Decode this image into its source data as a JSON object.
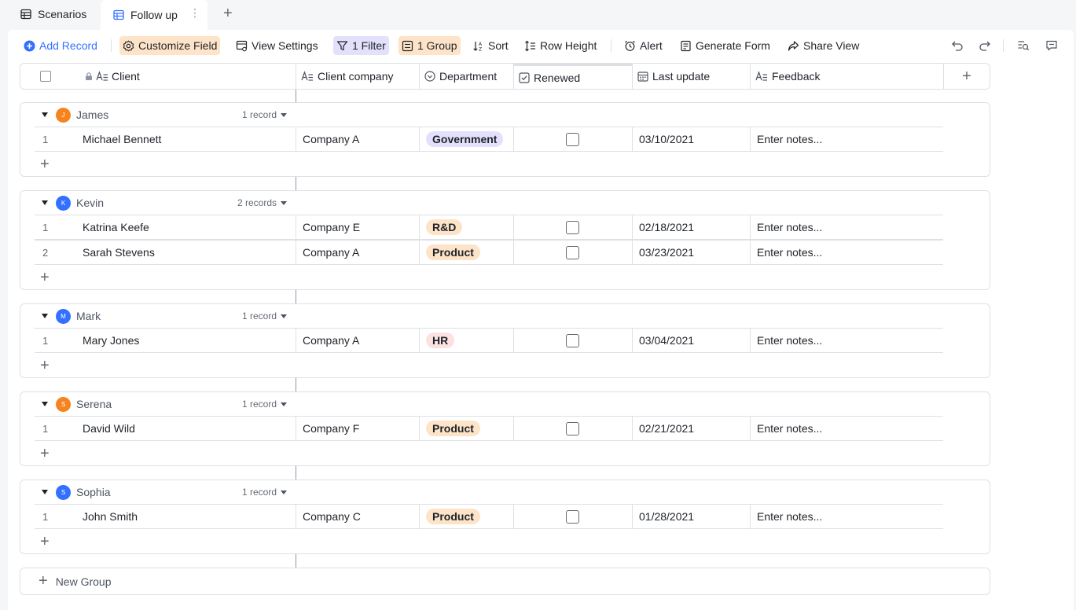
{
  "tabs": [
    {
      "label": "Scenarios",
      "icon": "grid-table-icon",
      "active": false
    },
    {
      "label": "Follow up",
      "icon": "grid-table-icon",
      "active": true
    }
  ],
  "toolbar": {
    "add_record": "Add Record",
    "customize_field": "Customize Field",
    "view_settings": "View Settings",
    "filter": "1 Filter",
    "group": "1 Group",
    "sort": "Sort",
    "row_height": "Row Height",
    "alert": "Alert",
    "generate_form": "Generate Form",
    "share_view": "Share View"
  },
  "columns": {
    "client": "Client",
    "client_company": "Client company",
    "department": "Department",
    "renewed": "Renewed",
    "last_update": "Last update",
    "feedback": "Feedback"
  },
  "groups": [
    {
      "name": "James",
      "initial": "J",
      "color": "#f5841f",
      "count": "1 record",
      "rows": [
        {
          "num": "1",
          "client": "Michael Bennett",
          "company": "Company A",
          "department": "Government",
          "dept_bg": "#e2e0fa",
          "last_update": "03/10/2021",
          "feedback": "Enter notes..."
        }
      ]
    },
    {
      "name": "Kevin",
      "initial": "K",
      "color": "#3370ff",
      "count": "2 records",
      "rows": [
        {
          "num": "1",
          "client": "Katrina Keefe",
          "company": "Company E",
          "department": "R&D",
          "dept_bg": "#fde3c7",
          "last_update": "02/18/2021",
          "feedback": "Enter notes..."
        },
        {
          "num": "2",
          "client": "Sarah Stevens",
          "company": "Company A",
          "department": "Product",
          "dept_bg": "#fde3c7",
          "last_update": "03/23/2021",
          "feedback": "Enter notes..."
        }
      ]
    },
    {
      "name": "Mark",
      "initial": "M",
      "color": "#3370ff",
      "count": "1 record",
      "rows": [
        {
          "num": "1",
          "client": "Mary Jones",
          "company": "Company A",
          "department": "HR",
          "dept_bg": "#fbe2e0",
          "last_update": "03/04/2021",
          "feedback": "Enter notes..."
        }
      ]
    },
    {
      "name": "Serena",
      "initial": "S",
      "color": "#f5841f",
      "count": "1 record",
      "rows": [
        {
          "num": "1",
          "client": "David Wild",
          "company": "Company F",
          "department": "Product",
          "dept_bg": "#fde3c7",
          "last_update": "02/21/2021",
          "feedback": "Enter notes..."
        }
      ]
    },
    {
      "name": "Sophia",
      "initial": "S",
      "color": "#3370ff",
      "count": "1 record",
      "rows": [
        {
          "num": "1",
          "client": "John Smith",
          "company": "Company C",
          "department": "Product",
          "dept_bg": "#fde3c7",
          "last_update": "01/28/2021",
          "feedback": "Enter notes..."
        }
      ]
    }
  ],
  "new_group": "New Group"
}
